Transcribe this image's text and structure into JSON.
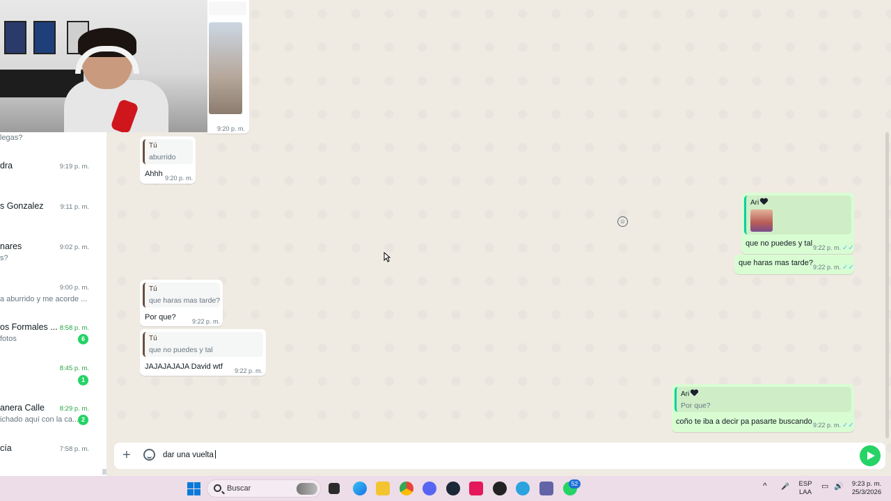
{
  "sidebar": {
    "chats": [
      {
        "name": "",
        "preview": "legas?",
        "time": "",
        "unread": false,
        "badge": ""
      },
      {
        "name": "dra",
        "preview": "",
        "time": "9:19 p. m.",
        "unread": false,
        "badge": ""
      },
      {
        "name": "s Gonzalez",
        "preview": "",
        "time": "9:11 p. m.",
        "unread": false,
        "badge": ""
      },
      {
        "name": "nares",
        "preview": "s?",
        "time": "9:02 p. m.",
        "unread": false,
        "badge": ""
      },
      {
        "name": "",
        "preview": "a aburrido y me acorde ...",
        "time": "9:00 p. m.",
        "unread": false,
        "badge": ""
      },
      {
        "name": "os Formales ...",
        "preview": "fotos",
        "time": "8:58 p. m.",
        "unread": true,
        "badge": "6"
      },
      {
        "name": "",
        "preview": "",
        "time": "8:45 p. m.",
        "unread": true,
        "badge": "1"
      },
      {
        "name": "anera Calle",
        "preview": "ichado aquí con la ca...",
        "time": "8:29 p. m.",
        "unread": true,
        "badge": "2"
      },
      {
        "name": "cía",
        "preview": "",
        "time": "7:58 p. m.",
        "unread": false,
        "badge": ""
      }
    ]
  },
  "messages": {
    "image_msg": {
      "time": "9:20 p. m."
    },
    "m1": {
      "quote_author": "Tú",
      "quote_text": "aburrido",
      "text": "Ahhh",
      "time": "9:20 p. m."
    },
    "m2": {
      "quote_author": "Ari",
      "text": "que no puedes y tal",
      "time": "9:22 p. m."
    },
    "m3": {
      "text": "que haras mas tarde?",
      "time": "9:22 p. m."
    },
    "m4": {
      "quote_author": "Tú",
      "quote_text": "que haras mas tarde?",
      "text": "Por que?",
      "time": "9:22 p. m."
    },
    "m5": {
      "quote_author": "Tú",
      "quote_text": "que no puedes y tal",
      "text": "JAJAJAJAJA David wtf",
      "time": "9:22 p. m."
    },
    "m6": {
      "quote_author": "Ari",
      "quote_text": "Por que?",
      "text": "coño te iba a decir pa pasarte buscando",
      "time": "9:22 p. m."
    },
    "read_ticks": "✓✓"
  },
  "composer": {
    "value": "dar una vuelta",
    "plus_icon": "plus-icon",
    "sticker_icon": "sticker-icon",
    "send_icon": "send-icon"
  },
  "taskbar": {
    "search_placeholder": "Buscar",
    "apps": [
      "windows-start",
      "file-explorer",
      "edge",
      "folder",
      "chrome",
      "discord",
      "steam",
      "tiktok",
      "obs",
      "telegram",
      "teams",
      "whatsapp"
    ],
    "whatsapp_badge": "52",
    "language": "ESP",
    "layout": "LAA",
    "time": "9:23 p. m.",
    "date": "25/3/2026"
  },
  "colors": {
    "outgoing_bubble": "#d9fdd3",
    "incoming_bubble": "#ffffff",
    "chat_bg": "#efeae2",
    "accent": "#25d366",
    "read_ticks": "#53bdeb"
  }
}
